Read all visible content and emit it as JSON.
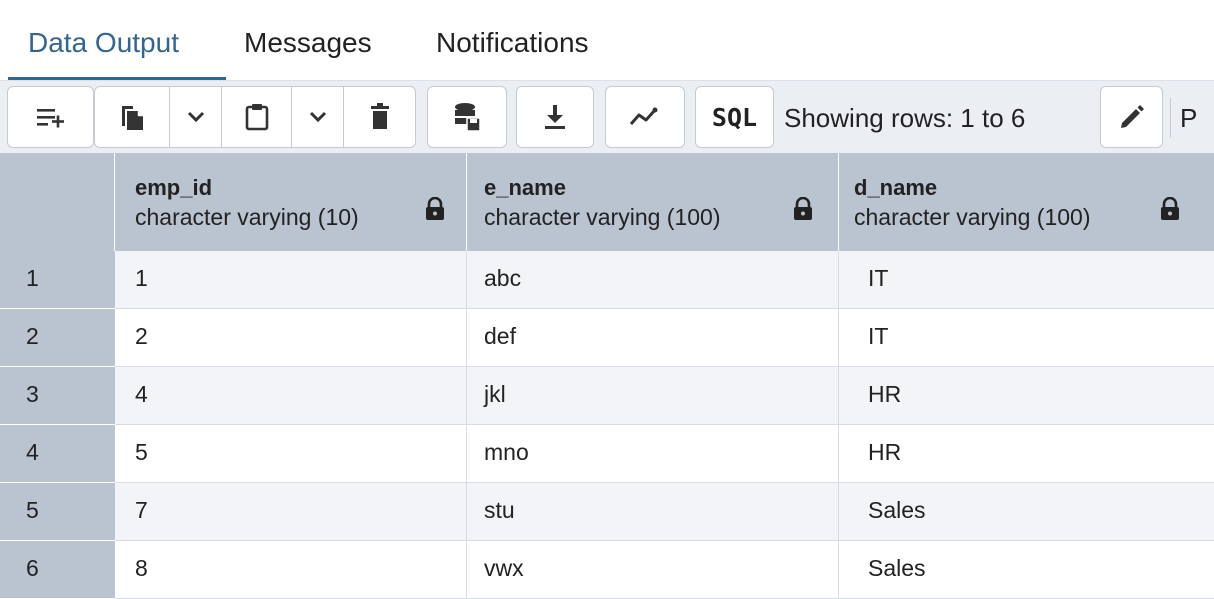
{
  "tabs": [
    {
      "label": "Data Output",
      "active": true
    },
    {
      "label": "Messages",
      "active": false
    },
    {
      "label": "Notifications",
      "active": false
    }
  ],
  "toolbar": {
    "buttons": [
      {
        "icon": "add-row-icon"
      },
      {
        "icon": "copy-icon"
      },
      {
        "icon": "copy-options-chevron-icon"
      },
      {
        "icon": "paste-icon"
      },
      {
        "icon": "paste-options-chevron-icon"
      },
      {
        "icon": "delete-icon"
      },
      {
        "icon": "save-data-icon"
      },
      {
        "icon": "download-icon"
      },
      {
        "icon": "graph-visualiser-icon"
      },
      {
        "icon": "sql-icon",
        "label": "SQL"
      },
      {
        "icon": "edit-icon"
      }
    ],
    "rows_info": "Showing rows: 1 to 6",
    "clipped_text": "P"
  },
  "grid": {
    "columns": [
      {
        "name": "emp_id",
        "type": "character varying (10)",
        "icon": "lock-icon"
      },
      {
        "name": "e_name",
        "type": "character varying (100)",
        "icon": "lock-icon"
      },
      {
        "name": "d_name",
        "type": "character varying (100)",
        "icon": "lock-icon"
      }
    ],
    "rows": [
      {
        "num": "1",
        "cells": [
          "1",
          "abc",
          "IT"
        ]
      },
      {
        "num": "2",
        "cells": [
          "2",
          "def",
          "IT"
        ]
      },
      {
        "num": "3",
        "cells": [
          "4",
          "jkl",
          "HR"
        ]
      },
      {
        "num": "4",
        "cells": [
          "5",
          "mno",
          "HR"
        ]
      },
      {
        "num": "5",
        "cells": [
          "7",
          "stu",
          "Sales"
        ]
      },
      {
        "num": "6",
        "cells": [
          "8",
          "vwx",
          "Sales"
        ]
      }
    ]
  },
  "colors": {
    "accent": "#326690",
    "toolbar_bg": "#ebeef3",
    "header_bg": "#bac3d0",
    "row_alt_bg": "#f2f4f7"
  }
}
